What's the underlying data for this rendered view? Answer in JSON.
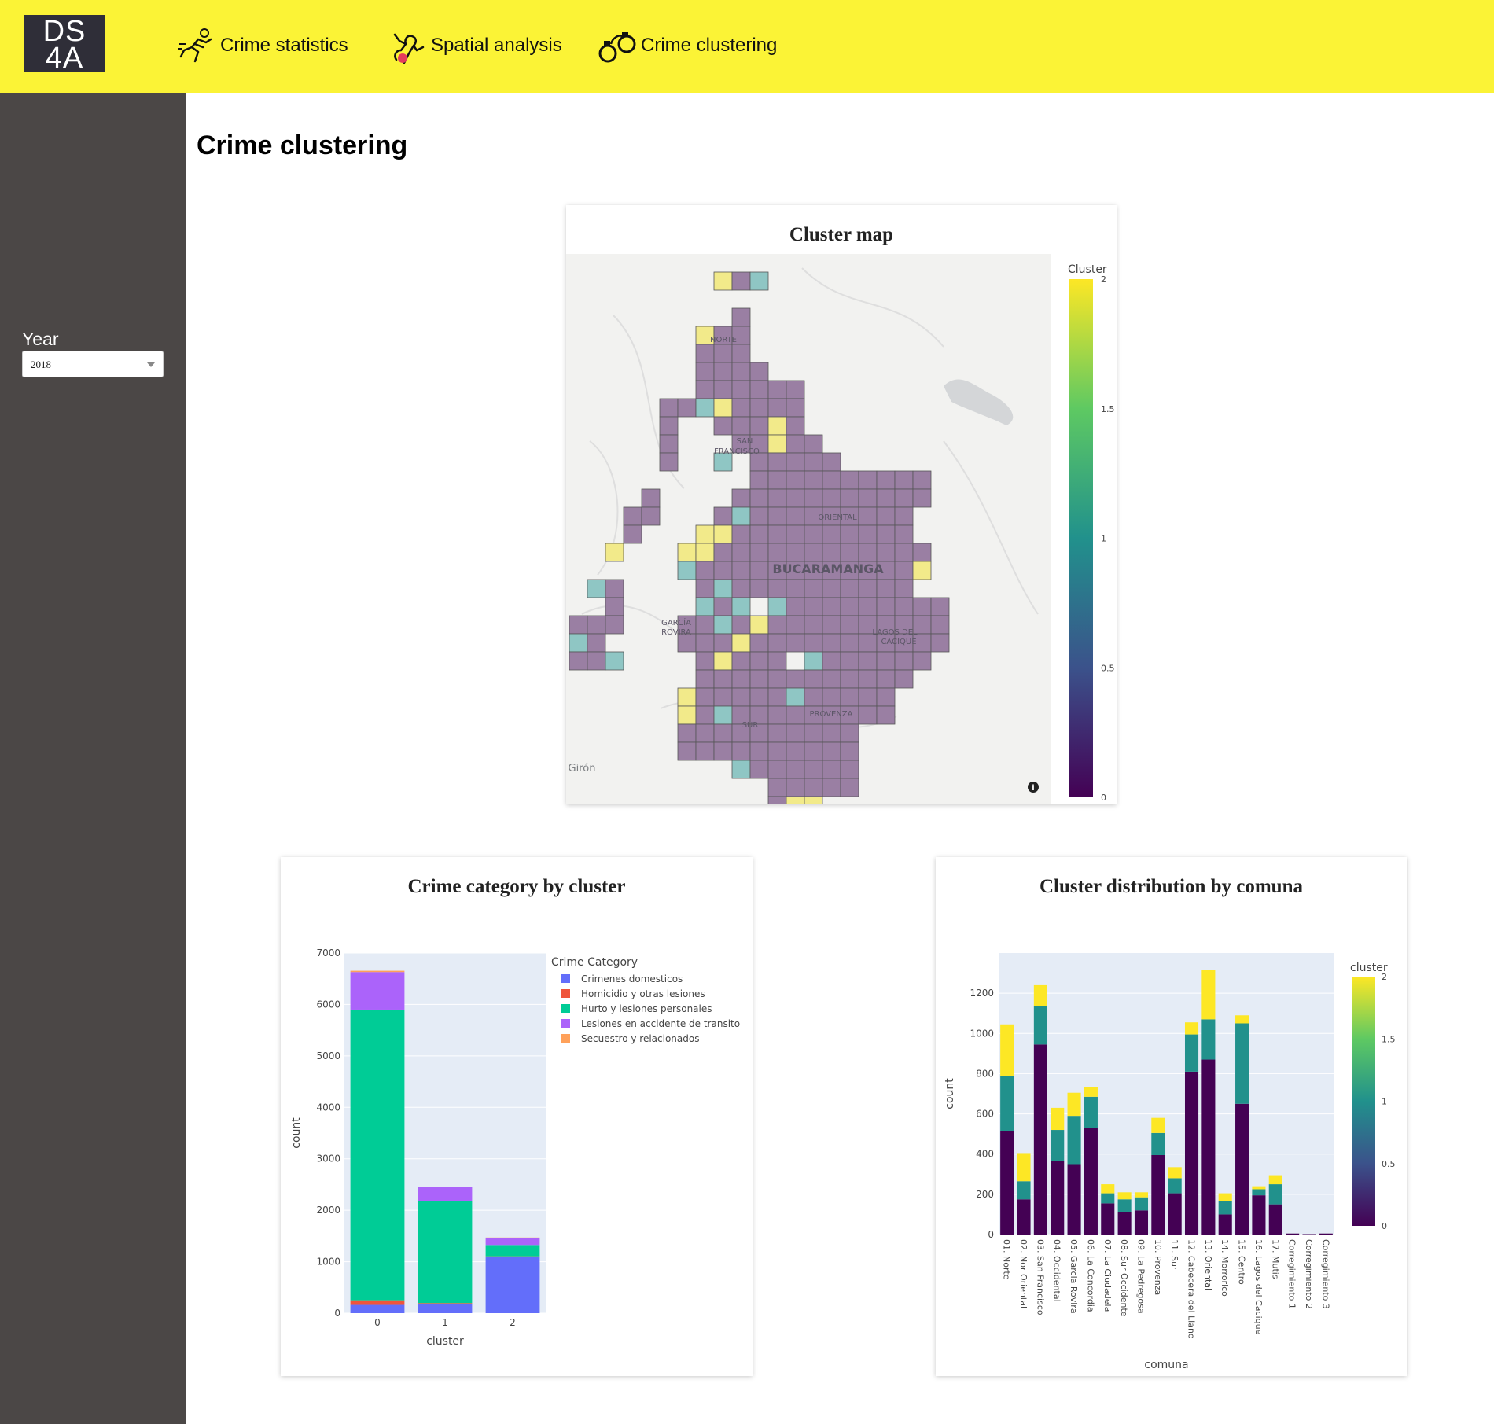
{
  "logo": {
    "line1": "DS",
    "line2": "4A"
  },
  "nav": [
    {
      "label": "Crime statistics",
      "icon": "runner-icon"
    },
    {
      "label": "Spatial analysis",
      "icon": "body-outline-icon"
    },
    {
      "label": "Crime clustering",
      "icon": "handcuffs-icon"
    }
  ],
  "sidebar": {
    "year_label": "Year",
    "year_value": "2018"
  },
  "page_title": "Crime clustering",
  "map_card": {
    "title": "Cluster map",
    "colorbar_title": "Cluster",
    "colorbar_ticks": [
      "2",
      "1.5",
      "1",
      "0.5",
      "0"
    ],
    "place_labels": [
      "NORTE",
      "SAN",
      "FRANCISCO",
      "ORIENTAL",
      "BUCARAMANGA",
      "GARCÍA",
      "ROVIRA",
      "LAGOS DEL",
      "CACIQUE",
      "PROVENZA",
      "SUR",
      "Girón"
    ],
    "colors": {
      "0": "#9a7fa3",
      "1": "#8fc6c4",
      "2": "#f2ea8a"
    }
  },
  "bar_card": {
    "title": "Crime category by cluster",
    "chart_data": {
      "type": "bar",
      "stacked": true,
      "categories": [
        "0",
        "1",
        "2"
      ],
      "xlabel": "cluster",
      "ylabel": "count",
      "ylim": [
        0,
        7000
      ],
      "yticks": [
        "0",
        "1000",
        "2000",
        "3000",
        "4000",
        "5000",
        "6000",
        "7000"
      ],
      "legend_title": "Crime Category",
      "series": [
        {
          "name": "Crimenes domesticos",
          "color": "#636efa",
          "values": [
            160,
            175,
            1100
          ]
        },
        {
          "name": "Homicidio y otras lesiones",
          "color": "#ef553b",
          "values": [
            90,
            20,
            5
          ]
        },
        {
          "name": "Hurto y lesiones personales",
          "color": "#00cc96",
          "values": [
            5650,
            1990,
            220
          ]
        },
        {
          "name": "Lesiones en accidente de transito",
          "color": "#ab63fa",
          "values": [
            730,
            270,
            140
          ]
        },
        {
          "name": "Secuestro y relacionados",
          "color": "#ffa15a",
          "values": [
            25,
            5,
            5
          ]
        }
      ]
    }
  },
  "comuna_card": {
    "title": "Cluster distribution by comuna",
    "chart_data": {
      "type": "bar",
      "stacked": true,
      "xlabel": "comuna",
      "ylabel": "count",
      "ylim": [
        0,
        1400
      ],
      "yticks": [
        "0",
        "200",
        "400",
        "600",
        "800",
        "1000",
        "1200"
      ],
      "colorbar_title": "cluster",
      "colorbar_ticks": [
        "2",
        "1.5",
        "1",
        "0.5",
        "0"
      ],
      "categories": [
        "01. Norte",
        "02. Nor Oriental",
        "03. San Francisco",
        "04. Occidental",
        "05. Garcia Rovira",
        "06. La Concordia",
        "07. La Ciudadela",
        "08. Sur Occidente",
        "09. La Pedregosa",
        "10. Provenza",
        "11. Sur",
        "12. Cabecera del Llano",
        "13. Oriental",
        "14. Morrorico",
        "15. Centro",
        "16. Lagos del Cacique",
        "17. Mutis",
        "Corregimiento 1",
        "Corregimiento 2",
        "Corregimiento 3"
      ],
      "series": [
        {
          "name": "0",
          "color": "#440154",
          "values": [
            515,
            175,
            945,
            365,
            350,
            530,
            155,
            110,
            120,
            395,
            205,
            810,
            870,
            100,
            650,
            195,
            150,
            5,
            2,
            5
          ]
        },
        {
          "name": "1",
          "color": "#21918c",
          "values": [
            275,
            90,
            190,
            155,
            240,
            155,
            50,
            65,
            65,
            110,
            75,
            185,
            200,
            65,
            400,
            30,
            100,
            0,
            0,
            0
          ]
        },
        {
          "name": "2",
          "color": "#fde725",
          "values": [
            255,
            140,
            105,
            110,
            115,
            50,
            45,
            35,
            25,
            75,
            55,
            60,
            245,
            40,
            40,
            15,
            45,
            0,
            0,
            0
          ]
        }
      ]
    }
  }
}
